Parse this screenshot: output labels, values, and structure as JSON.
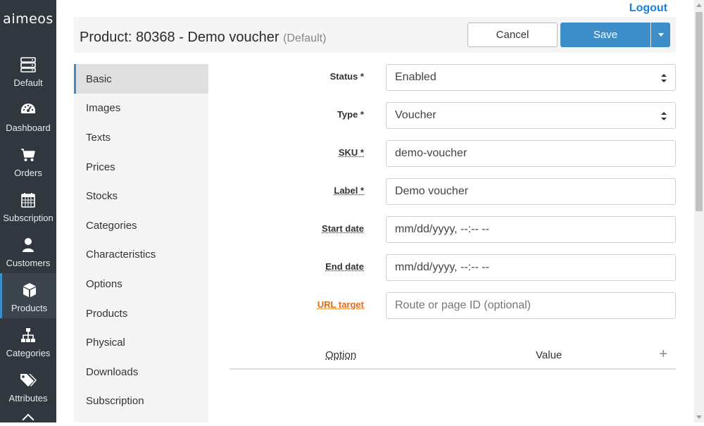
{
  "app": {
    "logo": "aimeos",
    "logout_label": "Logout"
  },
  "nav": [
    {
      "label": "Default",
      "icon": "server-icon",
      "active": false
    },
    {
      "label": "Dashboard",
      "icon": "gauge-icon",
      "active": false
    },
    {
      "label": "Orders",
      "icon": "cart-icon",
      "active": false
    },
    {
      "label": "Subscription",
      "icon": "calendar-icon",
      "active": false
    },
    {
      "label": "Customers",
      "icon": "user-icon",
      "active": false
    },
    {
      "label": "Products",
      "icon": "cube-icon",
      "active": true
    },
    {
      "label": "Categories",
      "icon": "sitemap-icon",
      "active": false
    },
    {
      "label": "Attributes",
      "icon": "tags-icon",
      "active": false
    }
  ],
  "header": {
    "title": "Product: 80368 - Demo voucher",
    "subtitle": "(Default)",
    "cancel_label": "Cancel",
    "save_label": "Save"
  },
  "tabs": [
    {
      "label": "Basic",
      "active": true
    },
    {
      "label": "Images"
    },
    {
      "label": "Texts"
    },
    {
      "label": "Prices"
    },
    {
      "label": "Stocks"
    },
    {
      "label": "Categories"
    },
    {
      "label": "Characteristics"
    },
    {
      "label": "Options"
    },
    {
      "label": "Products"
    },
    {
      "label": "Physical"
    },
    {
      "label": "Downloads"
    },
    {
      "label": "Subscription"
    }
  ],
  "form": {
    "status": {
      "label": "Status *",
      "value": "Enabled"
    },
    "type": {
      "label": "Type *",
      "value": "Voucher"
    },
    "sku": {
      "label": "SKU *",
      "value": "demo-voucher"
    },
    "label": {
      "label": "Label *",
      "value": "Demo voucher"
    },
    "start_date": {
      "label": "Start date",
      "value": "mm/dd/yyyy, --:-- --"
    },
    "end_date": {
      "label": "End date",
      "value": "mm/dd/yyyy, --:-- --"
    },
    "url_target": {
      "label": "URL target",
      "placeholder": "Route or page ID (optional)"
    }
  },
  "options_table": {
    "col_option": "Option",
    "col_value": "Value",
    "add_symbol": "+"
  },
  "colors": {
    "nav_bg": "#30373e",
    "accent": "#3d8dc9",
    "link": "#1a7fd8",
    "warning_label": "#e46b16"
  }
}
